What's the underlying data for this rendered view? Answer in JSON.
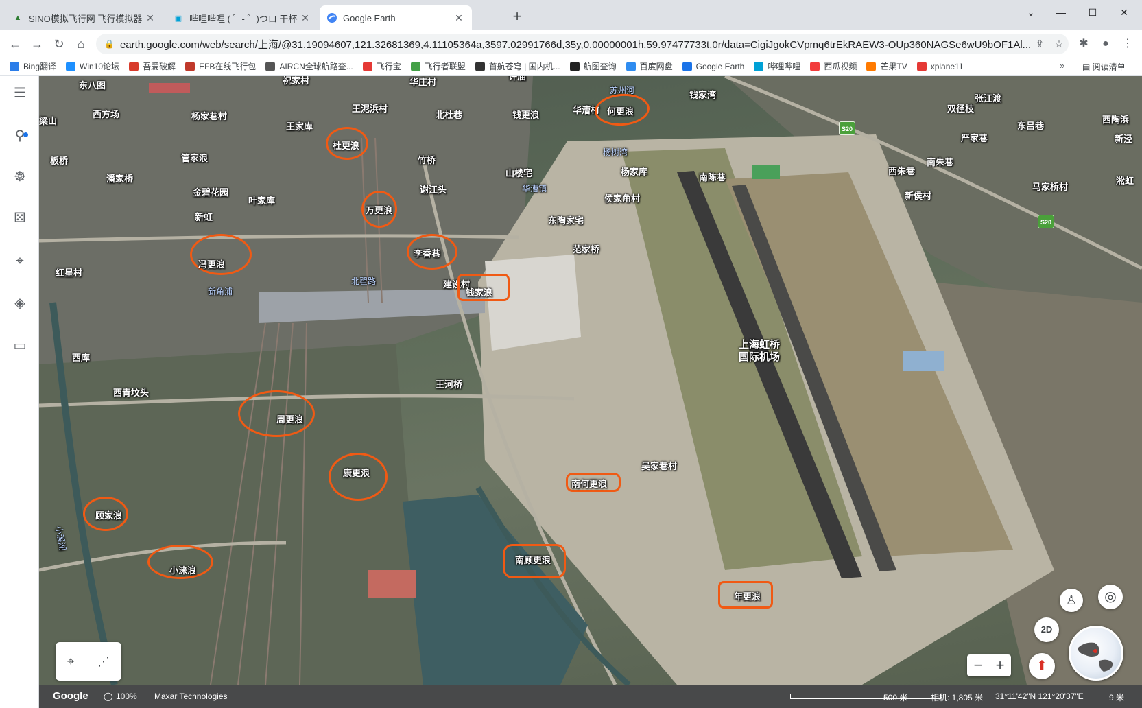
{
  "browser": {
    "tabs": [
      {
        "title": "SINO模拟飞行网 飞行模拟器 FS...",
        "active": false
      },
      {
        "title": "哔哩哔哩 ( ゜- ゜)つロ 干杯~-bili...",
        "active": false
      },
      {
        "title": "Google Earth",
        "active": true
      }
    ],
    "url": "earth.google.com/web/search/上海/@31.19094607,121.32681369,4.11105364a,3597.02991766d,35y,0.00000001h,59.97477733t,0r/data=CigiJgokCVpmq6trEkRAEW3-OUp360NAGSe6wU9bOF1Al..."
  },
  "bookmarks": [
    {
      "label": "Bing翻译",
      "color": "#2b7de9"
    },
    {
      "label": "Win10论坛",
      "color": "#1e90ff"
    },
    {
      "label": "吾爱破解",
      "color": "#d83b2b"
    },
    {
      "label": "EFB在线飞行包",
      "color": "#c0392b"
    },
    {
      "label": "AIRCN全球航路查...",
      "color": "#555555"
    },
    {
      "label": "飞行宝",
      "color": "#e53935"
    },
    {
      "label": "飞行者联盟",
      "color": "#43a047"
    },
    {
      "label": "首航苍穹 | 国内机...",
      "color": "#333333"
    },
    {
      "label": "航图查询",
      "color": "#222222"
    },
    {
      "label": "百度网盘",
      "color": "#2f8cf0"
    },
    {
      "label": "Google Earth",
      "color": "#1a73e8"
    },
    {
      "label": "哔哩哔哩",
      "color": "#00a1d6"
    },
    {
      "label": "西瓜视频",
      "color": "#f23c3c"
    },
    {
      "label": "芒果TV",
      "color": "#ff7a00"
    },
    {
      "label": "xplane11",
      "color": "#e53935"
    }
  ],
  "bookmarks_reading_list": "阅读清单",
  "map": {
    "places": [
      {
        "name": "东八图"
      },
      {
        "name": "祝家村"
      },
      {
        "name": "华庄村"
      },
      {
        "name": "许庙"
      },
      {
        "name": "苏州河"
      },
      {
        "name": "钱家湾"
      },
      {
        "name": "西方场"
      },
      {
        "name": "杨家巷村"
      },
      {
        "name": "王泥浜村"
      },
      {
        "name": "北杜巷"
      },
      {
        "name": "钱更浪"
      },
      {
        "name": "华漕村"
      },
      {
        "name": "双径枝"
      },
      {
        "name": "张江渡"
      },
      {
        "name": "梁山"
      },
      {
        "name": "王家库"
      },
      {
        "name": "东吕巷"
      },
      {
        "name": "严家巷"
      },
      {
        "name": "西陶浜"
      },
      {
        "name": "新泾"
      },
      {
        "name": "板桥"
      },
      {
        "name": "管家浪"
      },
      {
        "name": "竹桥"
      },
      {
        "name": "杨树湾"
      },
      {
        "name": "山楼宅"
      },
      {
        "name": "杨家库"
      },
      {
        "name": "南陈巷"
      },
      {
        "name": "西朱巷"
      },
      {
        "name": "南朱巷"
      },
      {
        "name": "潘家桥"
      },
      {
        "name": "谢江头"
      },
      {
        "name": "华漕镇"
      },
      {
        "name": "马家桥村"
      },
      {
        "name": "淞虹"
      },
      {
        "name": "金碧花园"
      },
      {
        "name": "侯家角村"
      },
      {
        "name": "新侯村"
      },
      {
        "name": "叶家库"
      },
      {
        "name": "新虹"
      },
      {
        "name": "东陶家宅"
      },
      {
        "name": "范家桥"
      },
      {
        "name": "红星村"
      },
      {
        "name": "北翟路"
      },
      {
        "name": "建设村"
      },
      {
        "name": "新角浦"
      },
      {
        "name": "西库"
      },
      {
        "name": "西青坟头"
      },
      {
        "name": "王河桥"
      },
      {
        "name": "吴家巷村"
      },
      {
        "name": "小溪湖"
      },
      {
        "name": "上海虹桥\n国际机场"
      }
    ],
    "circled_places": [
      {
        "name": "何更浪"
      },
      {
        "name": "杜更浪"
      },
      {
        "name": "万更浪"
      },
      {
        "name": "李香巷"
      },
      {
        "name": "冯更浪"
      },
      {
        "name": "钱家浪"
      },
      {
        "name": "周更浪"
      },
      {
        "name": "康更浪"
      },
      {
        "name": "南何更浪"
      },
      {
        "name": "顾家浪"
      },
      {
        "name": "小涞浪"
      },
      {
        "name": "南顾更浪"
      },
      {
        "name": "年更浪"
      }
    ],
    "road_shields": [
      "S20",
      "S20"
    ],
    "controls": {
      "view_2d": "2D"
    }
  },
  "statusbar": {
    "brand": "Google",
    "loading": "100%",
    "attribution": "Maxar Technologies",
    "scale": "500 米",
    "camera": "相机: 1,805 米",
    "coordinates": "31°11'42\"N 121°20'37\"E",
    "elevation": "9 米"
  }
}
